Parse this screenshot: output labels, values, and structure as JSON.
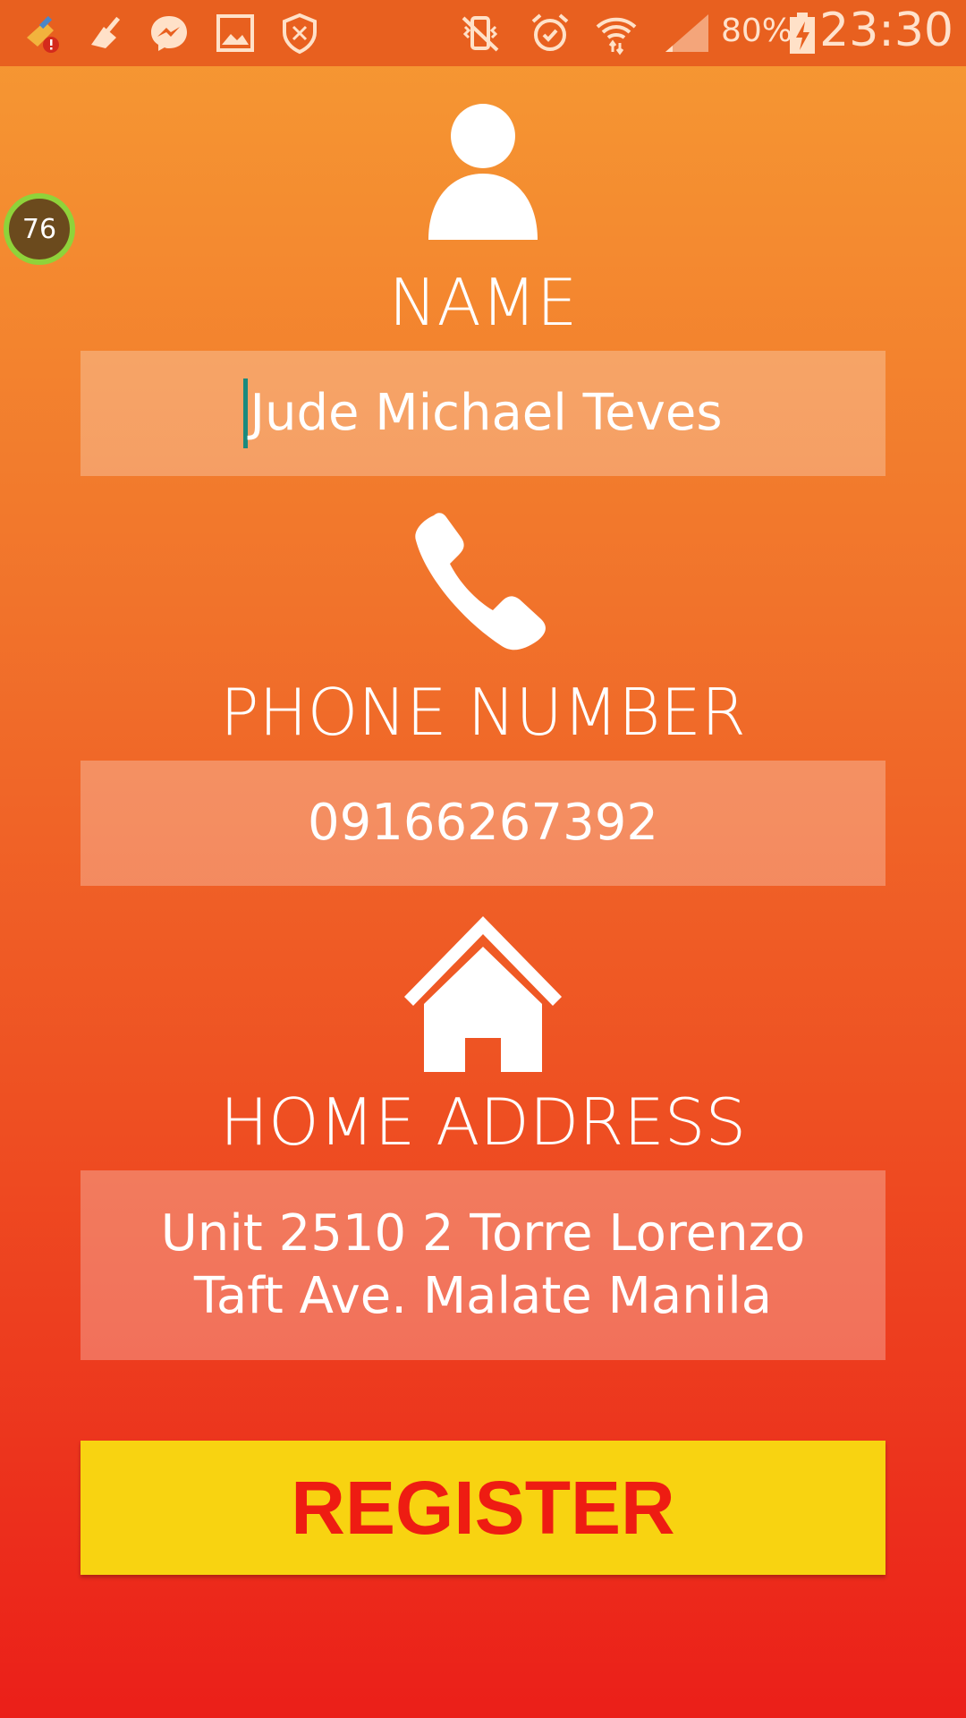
{
  "status_bar": {
    "battery": "80%",
    "time": "23:30",
    "icons": [
      "cleaner-alert-icon",
      "broom-icon",
      "messenger-icon",
      "gallery-icon",
      "shield-icon",
      "vibrate-icon",
      "alarm-icon",
      "wifi-icon",
      "signal-icon",
      "battery-charging-icon"
    ]
  },
  "bubble": {
    "value": "76"
  },
  "name": {
    "label": "NAME",
    "value": "Jude Michael Teves"
  },
  "phone": {
    "label": "PHONE NUMBER",
    "value": "09166267392"
  },
  "address": {
    "label": "HOME ADDRESS",
    "line1": "Unit 2510 2 Torre Lorenzo",
    "line2": "Taft Ave. Malate Manila"
  },
  "register": {
    "label": "REGISTER"
  },
  "colors": {
    "accent": "#f8d311",
    "button_text": "#ee1c12",
    "status_bar": "#e8601f"
  }
}
